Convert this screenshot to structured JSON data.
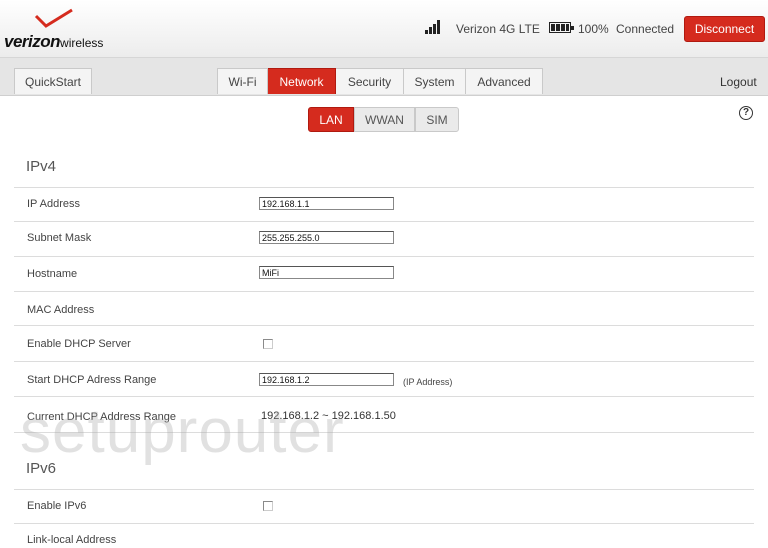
{
  "brand": {
    "logo_text": "verizon",
    "logo_suffix": "wireless",
    "check_color": "#d52b1e"
  },
  "status": {
    "network": "Verizon 4G LTE",
    "battery": "100%",
    "connection": "Connected",
    "disconnect_label": "Disconnect"
  },
  "nav": {
    "quickstart": "QuickStart",
    "tabs": [
      "Wi-Fi",
      "Network",
      "Security",
      "System",
      "Advanced"
    ],
    "active_tab": "Network",
    "logout": "Logout"
  },
  "subtabs": {
    "items": [
      "LAN",
      "WWAN",
      "SIM"
    ],
    "active": "LAN",
    "help": "?"
  },
  "ipv4": {
    "title": "IPv4",
    "ip_address": {
      "label": "IP Address",
      "value": "192.168.1.1"
    },
    "subnet_mask": {
      "label": "Subnet Mask",
      "value": "255.255.255.0"
    },
    "hostname": {
      "label": "Hostname",
      "value": "MiFi"
    },
    "mac_address": {
      "label": "MAC Address",
      "value": ""
    },
    "enable_dhcp": {
      "label": "Enable DHCP Server",
      "checked": false
    },
    "dhcp_start": {
      "label": "Start DHCP Adress Range",
      "value": "192.168.1.2",
      "note": "(IP Address)"
    },
    "dhcp_current": {
      "label": "Current DHCP Address Range",
      "value": "192.168.1.2 ~ 192.168.1.50"
    }
  },
  "ipv6": {
    "title": "IPv6",
    "enable_ipv6": {
      "label": "Enable IPv6",
      "checked": false
    },
    "link_local": {
      "label": "Link-local Address"
    }
  },
  "watermark": "setuprouter",
  "colors": {
    "accent": "#d52b1e"
  }
}
